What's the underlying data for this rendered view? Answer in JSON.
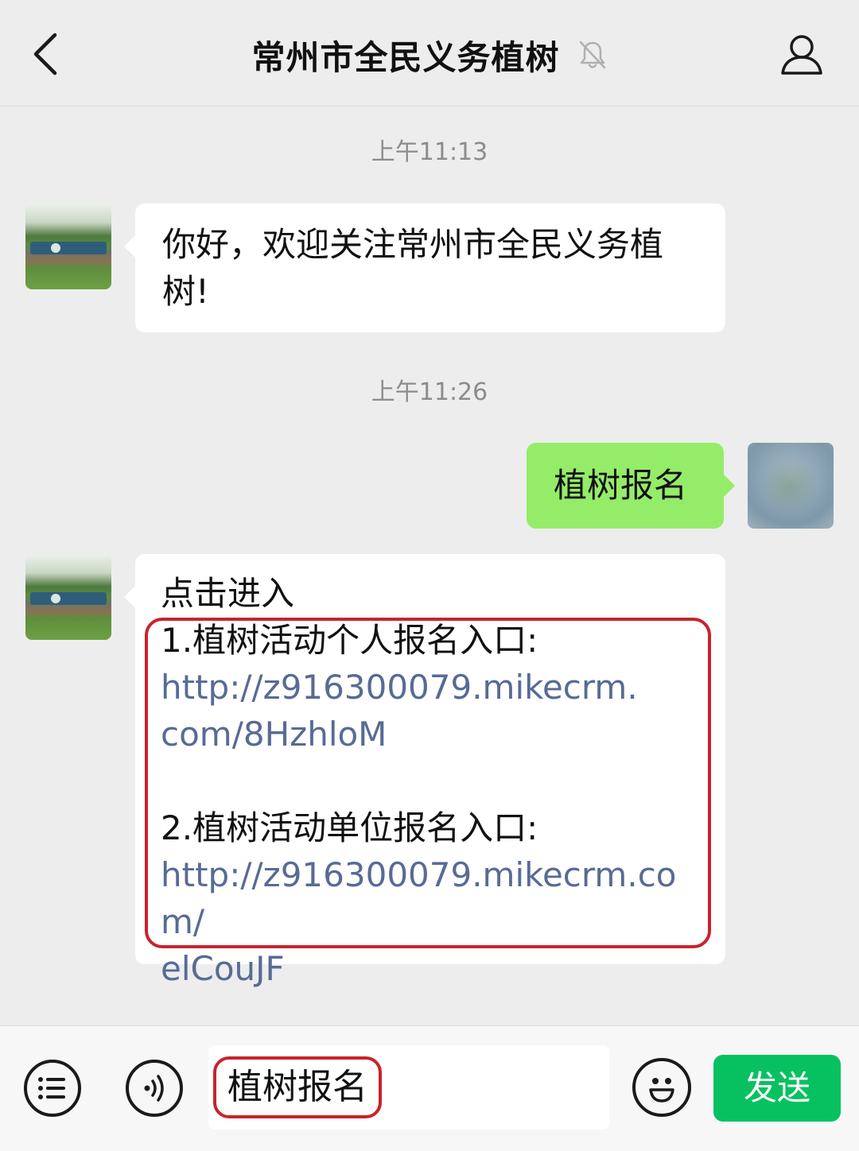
{
  "header": {
    "title": "常州市全民义务植树",
    "back_icon": "chevron-left-icon",
    "mute_icon": "bell-muted-icon",
    "profile_icon": "person-icon"
  },
  "messages": {
    "timestamp_1": "上午11:13",
    "welcome_line_1": "你好，欢迎关注常州市全民义务植",
    "welcome_line_2": "树!",
    "timestamp_2": "上午11:26",
    "user_message": "植树报名",
    "reply_intro": "点击进入",
    "personal_entry_label": "1.植树活动个人报名入口:",
    "personal_link_line_1": "http://z916300079.mikecrm.",
    "personal_link_line_2": "com/8HzhloM",
    "group_entry_label": "2.植树活动单位报名入口:",
    "group_link_line_1": "http://z916300079.mikecrm.com/",
    "group_link_line_2": "elCouJF"
  },
  "input_bar": {
    "menu_icon": "list-menu-icon",
    "voice_icon": "voice-icon",
    "emoji_icon": "smiley-icon",
    "input_value": "植树报名",
    "send_label": "发送"
  },
  "colors": {
    "background": "#ededed",
    "sent_bubble": "#95ec69",
    "link": "#576b95",
    "send_button": "#07c160",
    "highlight": "#c8232c"
  }
}
